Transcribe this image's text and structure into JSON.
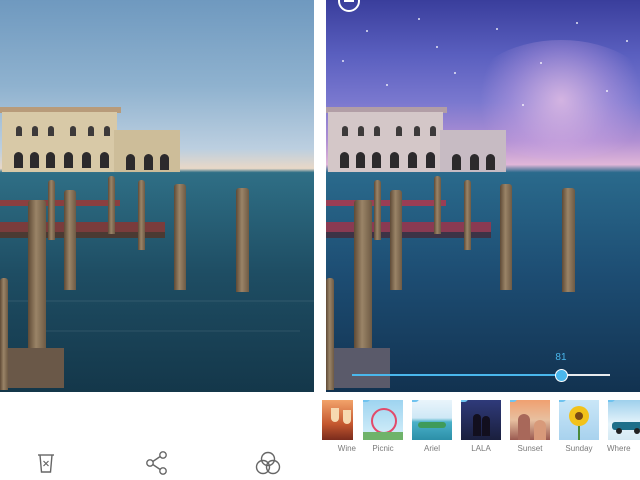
{
  "editor": {
    "intensity_value": "81",
    "intensity_fraction": 0.81
  },
  "filters": [
    {
      "label": "Wine",
      "icon": "wine-glasses"
    },
    {
      "label": "Picnic",
      "icon": "ferris-wheel"
    },
    {
      "label": "Ariel",
      "icon": "tropical-island"
    },
    {
      "label": "LALA",
      "icon": "night-couple"
    },
    {
      "label": "Sunset",
      "icon": "sunset-woman"
    },
    {
      "label": "Sunday",
      "icon": "sunflower"
    },
    {
      "label": "Where",
      "icon": "vintage-car"
    }
  ],
  "toolbar": {
    "items": [
      {
        "name": "delete",
        "icon": "trash-icon"
      },
      {
        "name": "share",
        "icon": "share-icon"
      },
      {
        "name": "filters",
        "icon": "filter-circles-icon"
      }
    ]
  },
  "colors": {
    "accent": "#4ab7ec",
    "toolbar_icon": "#666666",
    "label": "#7a7a7a"
  }
}
